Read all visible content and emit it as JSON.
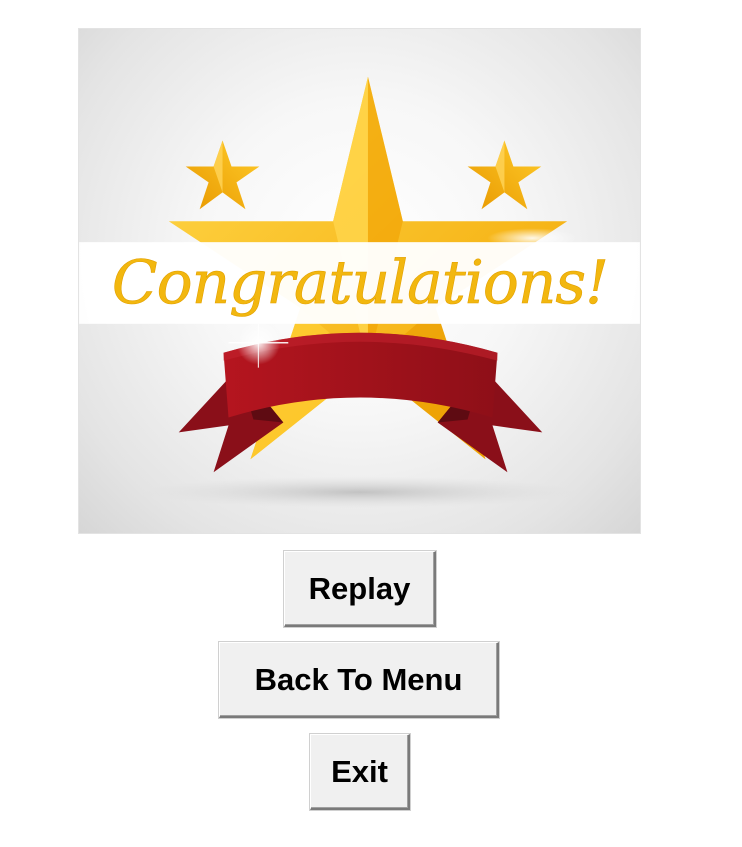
{
  "banner": {
    "text": "Congratulations!",
    "colors": {
      "star_gold": "#f5b400",
      "star_light": "#ffd23a",
      "ribbon_red": "#a3121c",
      "ribbon_dark": "#6b0f18",
      "text_gold": "#f2b70f"
    }
  },
  "buttons": {
    "replay_label": "Replay",
    "back_to_menu_label": "Back To Menu",
    "exit_label": "Exit"
  }
}
